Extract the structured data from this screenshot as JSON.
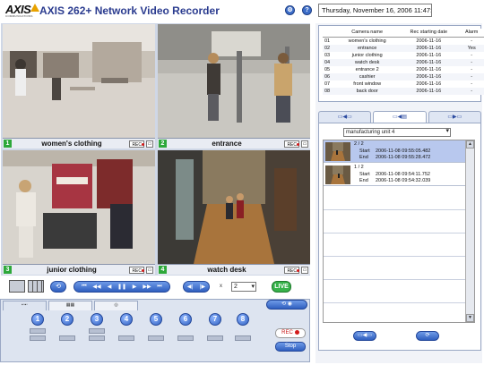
{
  "app": {
    "brand": "AXIS",
    "brand_sub": "COMMUNICATIONS",
    "title": "AXIS 262+ Network Video Recorder",
    "datetime": "Thursday, November 16, 2006 11:47:52 A",
    "help_icon": "help-icon",
    "settings_icon": "settings-icon"
  },
  "cameras": [
    {
      "num": "1",
      "name": "women's clothing",
      "rec": "REC"
    },
    {
      "num": "2",
      "name": "entrance",
      "rec": "REC"
    },
    {
      "num": "3",
      "name": "junior clothing",
      "rec": "REC"
    },
    {
      "num": "4",
      "name": "watch desk",
      "rec": "REC"
    }
  ],
  "playback": {
    "buttons": [
      "⏮",
      "◀◀",
      "◀",
      "❚❚",
      "▶",
      "▶▶",
      "⏭"
    ],
    "step_buttons": [
      "◀|",
      "|▶"
    ],
    "speed_label": "x",
    "speed_value": "2",
    "live_label": "LIVE"
  },
  "bottom": {
    "tabs": [
      "",
      "",
      ""
    ],
    "cam_numbers": [
      "1",
      "2",
      "3",
      "4",
      "5",
      "6",
      "7",
      "8"
    ],
    "rec_label": "REC",
    "stop_label": "Stop"
  },
  "table": {
    "headers": [
      "",
      "Camera name",
      "Rec starting date",
      "Alarm"
    ],
    "rows": [
      [
        "01",
        "women's clothing",
        "2006-11-16",
        "-"
      ],
      [
        "02",
        "entrance",
        "2006-11-16",
        "Yes"
      ],
      [
        "03",
        "junior clothing",
        "2006-11-16",
        "-"
      ],
      [
        "04",
        "watch desk",
        "2006-11-16",
        "-"
      ],
      [
        "05",
        "entrance 2",
        "2006-11-16",
        "-"
      ],
      [
        "06",
        "cashier",
        "2006-11-16",
        "-"
      ],
      [
        "07",
        "front window",
        "2006-11-16",
        "-"
      ],
      [
        "08",
        "back door",
        "2006-11-16",
        "-"
      ]
    ]
  },
  "recordings": {
    "unit": "manufacturing unit 4",
    "items": [
      {
        "index": "2 / 2",
        "start_label": "Start",
        "start": "2006-11-08 09:55:05.482",
        "end_label": "End",
        "end": "2006-11-08 09:55:28.472"
      },
      {
        "index": "1 / 2",
        "start_label": "Start",
        "start": "2006-11-08 09:54:11.752",
        "end_label": "End",
        "end": "2006-11-08 09:54:32.039"
      }
    ]
  },
  "colors": {
    "accent": "#2f5fbf",
    "live": "#37b24a",
    "cam_number": "#2da83a",
    "selection": "#b8c8ee"
  }
}
